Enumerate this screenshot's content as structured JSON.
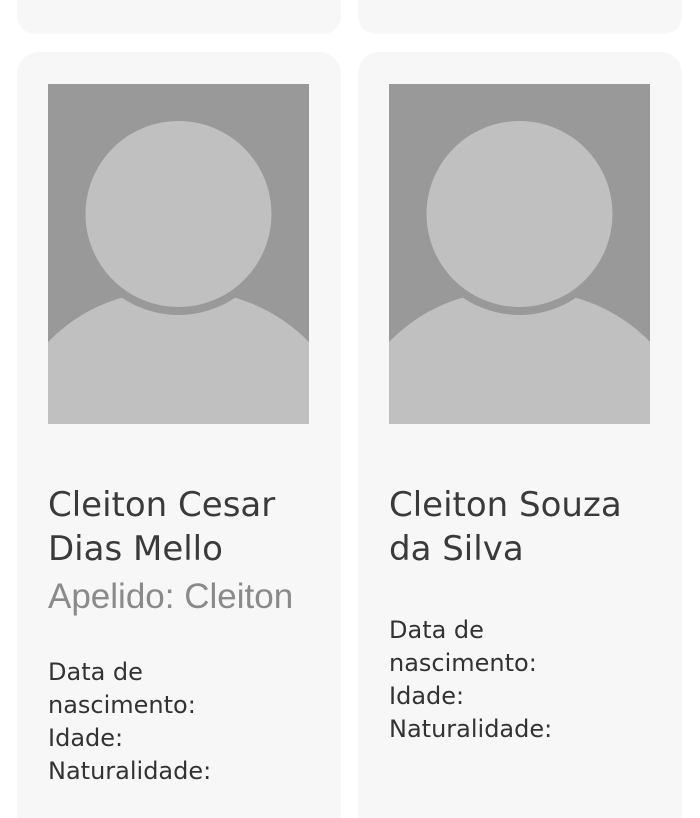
{
  "people": [
    {
      "name_line1": "Cleiton Cesar",
      "name_line2": "Dias Mello",
      "nickname": "Apelido: Cleiton",
      "birth_label_1": "Data de",
      "birth_label_2": "nascimento:",
      "age_label": "Idade:",
      "origin_label": "Naturalidade:"
    },
    {
      "name_line1": "Cleiton Souza",
      "name_line2": "da Silva",
      "birth_label_1": "Data de",
      "birth_label_2": "nascimento:",
      "age_label": "Idade:",
      "origin_label": "Naturalidade:"
    }
  ],
  "colors": {
    "card_background": "#f7f7f7",
    "avatar_background": "#999999",
    "avatar_silhouette": "#c0c0c0"
  },
  "icons": [
    "avatar-placeholder-icon"
  ]
}
